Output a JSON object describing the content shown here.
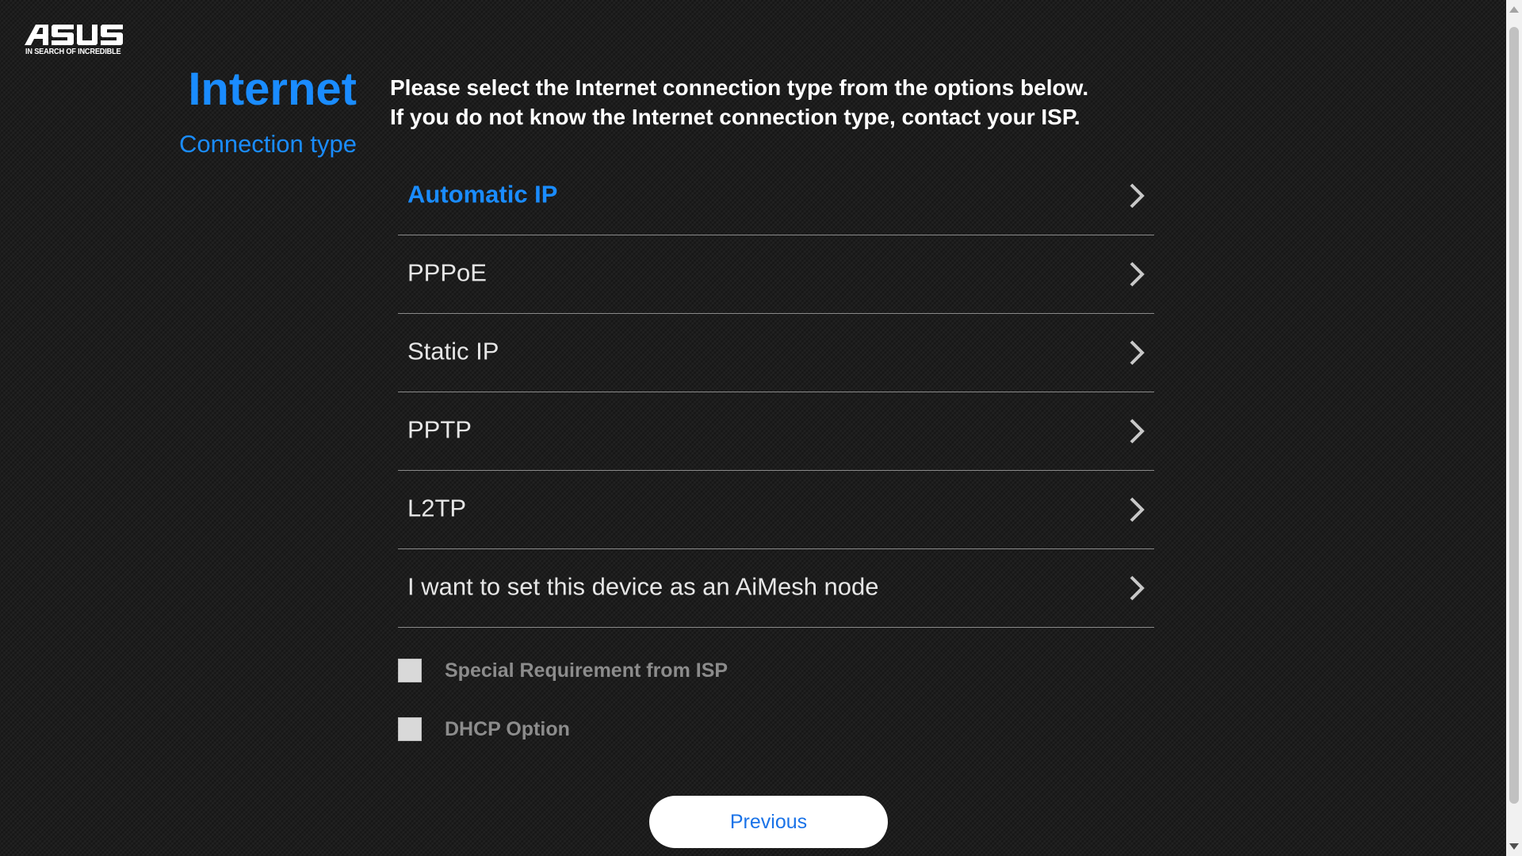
{
  "brand": {
    "logo_text": "ASUS",
    "tagline": "IN SEARCH OF INCREDIBLE"
  },
  "header": {
    "title": "Internet",
    "subtitle": "Connection type"
  },
  "instructions": {
    "line1": "Please select the Internet connection type from the options below.",
    "line2": "If you do not know the Internet connection type, contact your ISP."
  },
  "options": [
    {
      "label": "Automatic IP",
      "selected": true
    },
    {
      "label": "PPPoE",
      "selected": false
    },
    {
      "label": "Static IP",
      "selected": false
    },
    {
      "label": "PPTP",
      "selected": false
    },
    {
      "label": "L2TP",
      "selected": false
    },
    {
      "label": "I want to set this device as an AiMesh node",
      "selected": false
    }
  ],
  "checkboxes": [
    {
      "label": "Special Requirement from ISP",
      "checked": false
    },
    {
      "label": "DHCP Option",
      "checked": false
    }
  ],
  "buttons": {
    "previous_label": "Previous"
  },
  "colors": {
    "accent": "#1a8cff",
    "background": "#1d1d1d",
    "divider": "#8a8a8a",
    "option_text": "#e6e6e6",
    "checkbox_label": "#8c8c8c",
    "button_text": "#1a73e8"
  },
  "icons": {
    "option_arrow": "chevron-right-icon"
  }
}
